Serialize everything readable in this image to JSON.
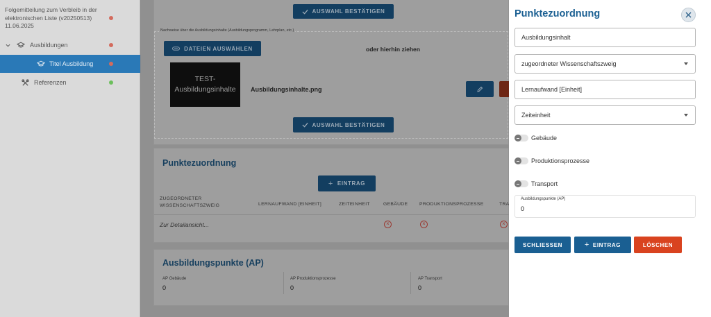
{
  "sidebar": {
    "document": {
      "title": "Folgemitteilung zum Verbleib in der elektronischen Liste (v20250513) 11.06.2025",
      "status_color": "#d36b5d"
    },
    "items": [
      {
        "label": "Ausbildungen",
        "icon": "graduation-cap-icon",
        "status_color": "#d36b5d",
        "expanded": true
      },
      {
        "label": "Titel Ausbildung",
        "icon": "graduation-cap-icon",
        "status_color": "#d36b5d",
        "active": true
      },
      {
        "label": "Referenzen",
        "icon": "tools-icon",
        "status_color": "#6cbf5c"
      }
    ]
  },
  "main": {
    "confirm_label": "AUSWAHL BESTÄTIGEN",
    "upload": {
      "legend": "Nachweise über die Ausbildungsinhalte (Ausbildungsprogramm, Lehrplan, etc.)",
      "choose_files_label": "DATEIEN AUSWÄHLEN",
      "drop_hint": "oder hierhin ziehen",
      "file": {
        "thumbnail_text": "TEST-Ausbildungsinhalte",
        "name": "Ausbildungsinhalte.png"
      }
    },
    "points": {
      "title": "Punktezuordnung",
      "add_label": "EINTRAG",
      "columns": [
        "ZUGEORDNETER WISSENSCHAFTSZWEIG",
        "LERNAUFWAND [EINHEIT]",
        "ZEITEINHEIT",
        "GEBÄUDE",
        "PRODUKTIONSPROZESSE",
        "TRA"
      ],
      "row_placeholder": "Zur Detailansicht..."
    },
    "ap": {
      "title": "Ausbildungspunkte (AP)",
      "fields": [
        {
          "label": "AP Gebäude",
          "value": "0"
        },
        {
          "label": "AP Produktionsprozesse",
          "value": "0"
        },
        {
          "label": "AP Transport",
          "value": "0"
        }
      ]
    }
  },
  "panel": {
    "title": "Punktezuordnung",
    "fields": {
      "inhalt": "Ausbildungsinhalt",
      "zweig": "zugeordneter Wissenschaftszweig",
      "lernaufwand": "Lernaufwand [Einheit]",
      "zeiteinheit": "Zeiteinheit"
    },
    "toggles": [
      {
        "label": "Gebäude",
        "on": false
      },
      {
        "label": "Produktionsprozesse",
        "on": false
      },
      {
        "label": "Transport",
        "on": false
      }
    ],
    "ap_field": {
      "label": "Ausbildungspunkte (AP)",
      "value": "0"
    },
    "buttons": {
      "close": "SCHLIESSEN",
      "add": "EINTRAG",
      "delete": "LÖSCHEN"
    },
    "colors": {
      "primary": "#1a5f92",
      "danger": "#d9431f",
      "title": "#1a5f92"
    }
  }
}
